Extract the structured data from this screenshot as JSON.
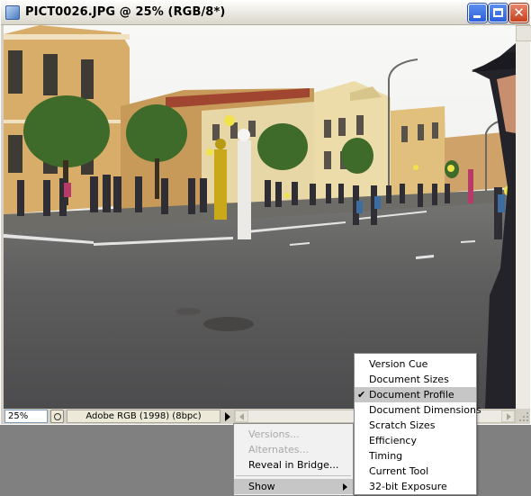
{
  "window": {
    "title": "PICT0026.JPG @ 25% (RGB/8*)",
    "controls": [
      "minimize",
      "maximize",
      "close"
    ],
    "close_glyph": "✕"
  },
  "statusbar": {
    "zoom": "25%",
    "info": "Adobe RGB (1998) (8bpc)"
  },
  "left_menu": {
    "items": [
      {
        "label": "Versions...",
        "disabled": true
      },
      {
        "label": "Alternates...",
        "disabled": true
      },
      {
        "label": "Reveal in Bridge...",
        "disabled": false
      }
    ],
    "show_label": "Show"
  },
  "show_submenu": {
    "items": [
      {
        "label": "Version Cue",
        "checked": false
      },
      {
        "label": "Document Sizes",
        "checked": false
      },
      {
        "label": "Document Profile",
        "checked": true
      },
      {
        "label": "Document Dimensions",
        "checked": false
      },
      {
        "label": "Scratch Sizes",
        "checked": false
      },
      {
        "label": "Efficiency",
        "checked": false
      },
      {
        "label": "Timing",
        "checked": false
      },
      {
        "label": "Current Tool",
        "checked": false
      },
      {
        "label": "32-bit Exposure",
        "checked": false
      }
    ],
    "check_glyph": "✔"
  }
}
